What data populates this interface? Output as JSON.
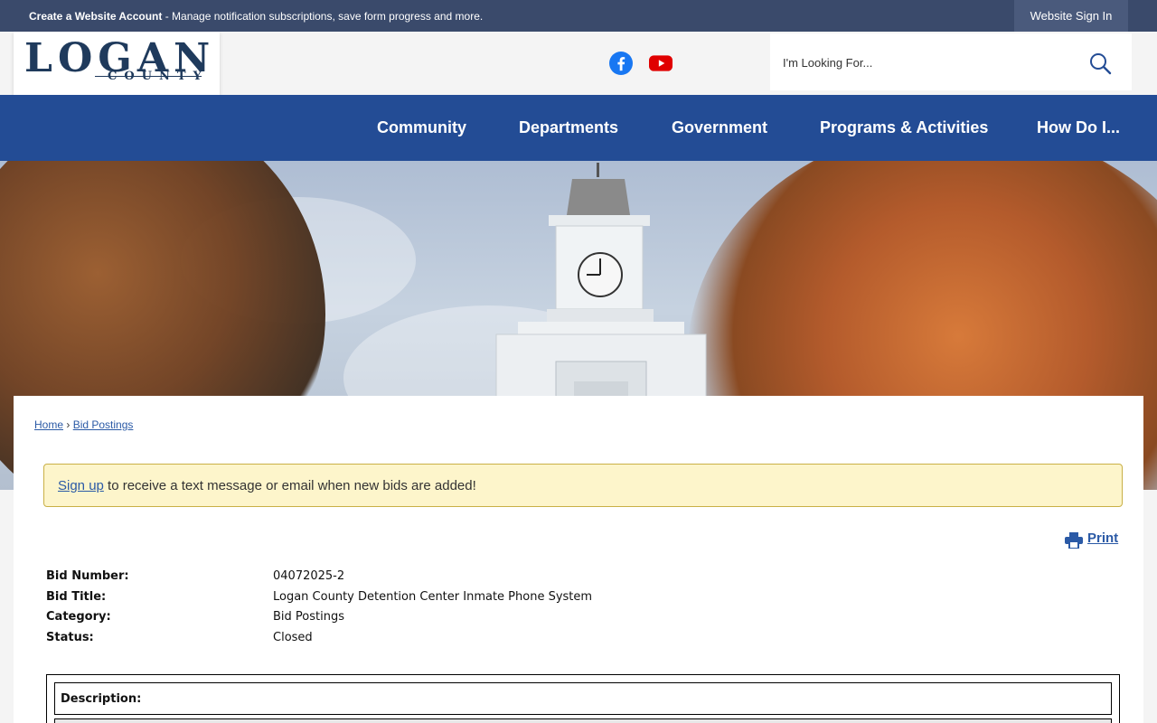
{
  "topbar": {
    "create_account_label": "Create a Website Account",
    "create_account_desc": " - Manage notification subscriptions, save form progress and more.",
    "signin_label": "Website Sign In"
  },
  "logo": {
    "word": "LOGAN",
    "subword": "COUNTY"
  },
  "social": {
    "facebook": "facebook-icon",
    "youtube": "youtube-icon",
    "facebook_color": "#1877f2",
    "youtube_color": "#e00000"
  },
  "search": {
    "placeholder": "I'm Looking For..."
  },
  "nav": {
    "items": [
      {
        "label": "Community"
      },
      {
        "label": "Departments"
      },
      {
        "label": "Government"
      },
      {
        "label": "Programs & Activities"
      },
      {
        "label": "How Do I..."
      }
    ]
  },
  "breadcrumb": {
    "home": "Home",
    "sep": "›",
    "current": "Bid Postings"
  },
  "alert": {
    "link": "Sign up",
    "text": " to receive a text message or email when new bids are added!"
  },
  "print": {
    "label": "Print"
  },
  "bid": {
    "number_label": "Bid Number:",
    "number": "04072025-2",
    "title_label": "Bid Title:",
    "title": "Logan County Detention Center Inmate Phone System",
    "category_label": "Category:",
    "category": "Bid Postings",
    "status_label": "Status:",
    "status": "Closed",
    "description_label": "Description:"
  },
  "colors": {
    "topbar": "#3a4a6b",
    "nav": "#234c95",
    "link": "#2b5aa6",
    "alert_bg": "#fdf5cb"
  }
}
